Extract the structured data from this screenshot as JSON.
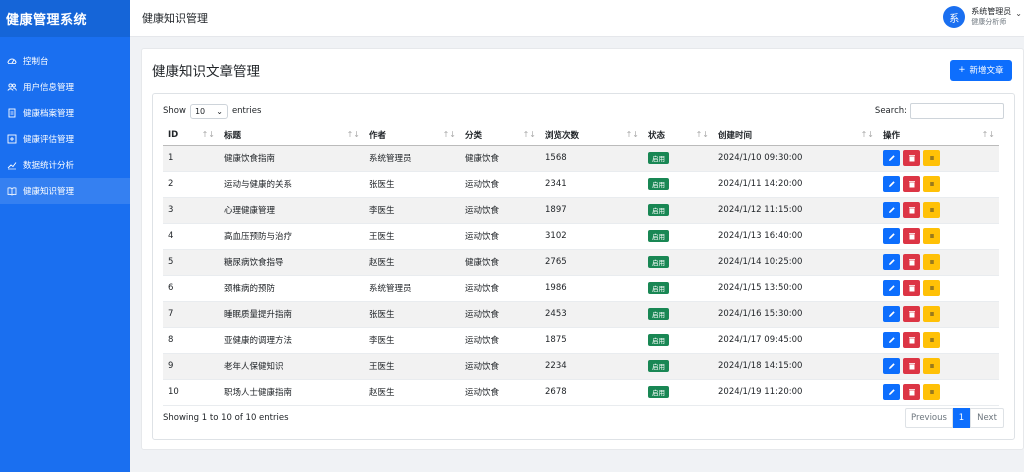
{
  "app": {
    "name": "健康管理系统"
  },
  "sidebar": {
    "items": [
      {
        "label": "控制台",
        "icon": "dashboard-icon",
        "active": false
      },
      {
        "label": "用户信息管理",
        "icon": "users-icon",
        "active": false
      },
      {
        "label": "健康档案管理",
        "icon": "file-icon",
        "active": false
      },
      {
        "label": "健康评估管理",
        "icon": "plus-square-icon",
        "active": false
      },
      {
        "label": "数据统计分析",
        "icon": "chart-line-icon",
        "active": false
      },
      {
        "label": "健康知识管理",
        "icon": "book-icon",
        "active": true
      }
    ]
  },
  "header": {
    "title": "健康知识管理",
    "user": {
      "avatar_text": "系",
      "name": "系统管理员",
      "role": "健康分析师"
    }
  },
  "main": {
    "title": "健康知识文章管理",
    "new_button": "新增文章",
    "length": {
      "show": "Show",
      "value": "10",
      "entries": "entries"
    },
    "search_label": "Search:",
    "search_value": "",
    "columns": [
      "ID",
      "标题",
      "作者",
      "分类",
      "浏览次数",
      "状态",
      "创建时间",
      "操作"
    ],
    "rows": [
      {
        "id": "1",
        "title": "健康饮食指南",
        "author": "系统管理员",
        "category": "健康饮食",
        "views": "1568",
        "status": "启用",
        "created": "2024/1/10 09:30:00"
      },
      {
        "id": "2",
        "title": "运动与健康的关系",
        "author": "张医生",
        "category": "运动饮食",
        "views": "2341",
        "status": "启用",
        "created": "2024/1/11 14:20:00"
      },
      {
        "id": "3",
        "title": "心理健康管理",
        "author": "李医生",
        "category": "运动饮食",
        "views": "1897",
        "status": "启用",
        "created": "2024/1/12 11:15:00"
      },
      {
        "id": "4",
        "title": "高血压预防与治疗",
        "author": "王医生",
        "category": "运动饮食",
        "views": "3102",
        "status": "启用",
        "created": "2024/1/13 16:40:00"
      },
      {
        "id": "5",
        "title": "糖尿病饮食指导",
        "author": "赵医生",
        "category": "健康饮食",
        "views": "2765",
        "status": "启用",
        "created": "2024/1/14 10:25:00"
      },
      {
        "id": "6",
        "title": "颈椎病的预防",
        "author": "系统管理员",
        "category": "运动饮食",
        "views": "1986",
        "status": "启用",
        "created": "2024/1/15 13:50:00"
      },
      {
        "id": "7",
        "title": "睡眠质量提升指南",
        "author": "张医生",
        "category": "运动饮食",
        "views": "2453",
        "status": "启用",
        "created": "2024/1/16 15:30:00"
      },
      {
        "id": "8",
        "title": "亚健康的调理方法",
        "author": "李医生",
        "category": "运动饮食",
        "views": "1875",
        "status": "启用",
        "created": "2024/1/17 09:45:00"
      },
      {
        "id": "9",
        "title": "老年人保健知识",
        "author": "王医生",
        "category": "运动饮食",
        "views": "2234",
        "status": "启用",
        "created": "2024/1/18 14:15:00"
      },
      {
        "id": "10",
        "title": "职场人士健康指南",
        "author": "赵医生",
        "category": "运动饮食",
        "views": "2678",
        "status": "启用",
        "created": "2024/1/19 11:20:00"
      }
    ],
    "info": "Showing 1 to 10 of 10 entries",
    "pager": {
      "prev": "Previous",
      "current": "1",
      "next": "Next"
    }
  },
  "colors": {
    "primary": "#1a6ff0",
    "success": "#198754",
    "danger": "#dc3545",
    "warning": "#ffc107"
  }
}
